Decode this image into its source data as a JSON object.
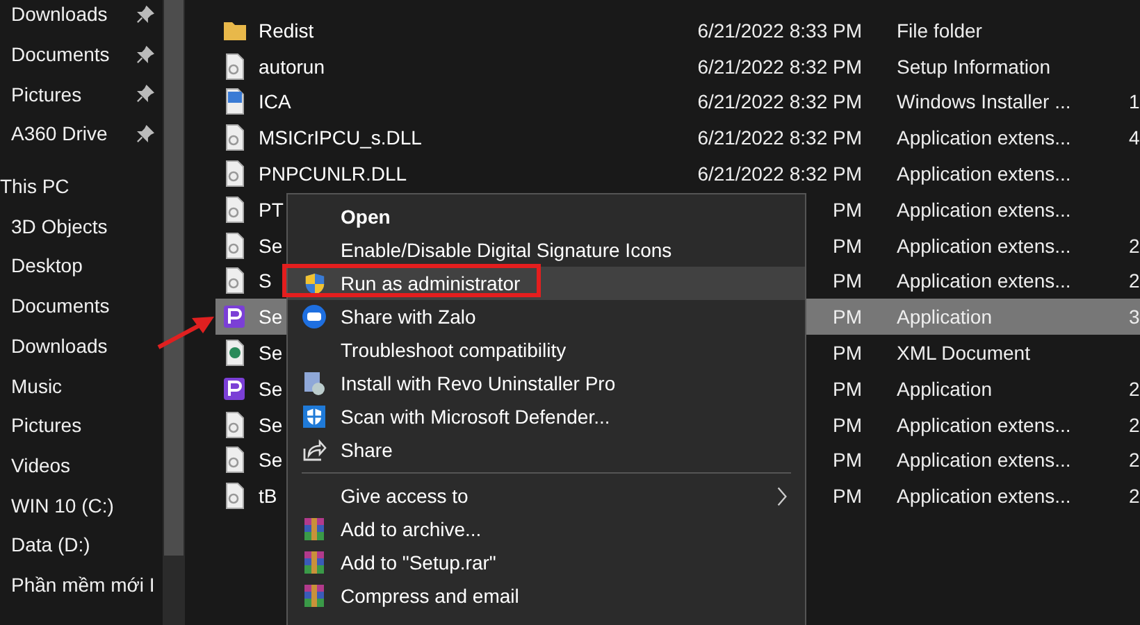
{
  "sidebar": {
    "items": [
      {
        "label": "Downloads",
        "kind": "item",
        "pinned": true
      },
      {
        "label": "Documents",
        "kind": "item",
        "pinned": true
      },
      {
        "label": "Pictures",
        "kind": "item",
        "pinned": true
      },
      {
        "label": "A360 Drive",
        "kind": "item",
        "pinned": true
      },
      {
        "label": "This PC",
        "kind": "header",
        "pinned": false
      },
      {
        "label": "3D Objects",
        "kind": "item",
        "pinned": false
      },
      {
        "label": "Desktop",
        "kind": "item",
        "pinned": false
      },
      {
        "label": "Documents",
        "kind": "item",
        "pinned": false
      },
      {
        "label": "Downloads",
        "kind": "item",
        "pinned": false
      },
      {
        "label": "Music",
        "kind": "item",
        "pinned": false
      },
      {
        "label": "Pictures",
        "kind": "item",
        "pinned": false
      },
      {
        "label": "Videos",
        "kind": "item",
        "pinned": false
      },
      {
        "label": "WIN 10 (C:)",
        "kind": "item",
        "pinned": false
      },
      {
        "label": "Data (D:)",
        "kind": "item",
        "pinned": false
      },
      {
        "label": "Phần mềm mới I",
        "kind": "item",
        "pinned": false
      }
    ]
  },
  "file_list": {
    "rows": [
      {
        "kind": "folder",
        "name": "Redist",
        "date": "6/21/2022 8:33 PM",
        "type": "File folder",
        "selected": false
      },
      {
        "kind": "setup",
        "name": "autorun",
        "date": "6/21/2022 8:32 PM",
        "type": "Setup Information",
        "selected": false
      },
      {
        "kind": "installer",
        "name": "ICA",
        "date": "6/21/2022 8:32 PM",
        "type": "Windows Installer ...",
        "size": "1",
        "selected": false
      },
      {
        "kind": "dll",
        "name": "MSICrIPCU_s.DLL",
        "date": "6/21/2022 8:32 PM",
        "type": "Application extens...",
        "size": "4",
        "selected": false
      },
      {
        "kind": "dll",
        "name": "PNPCUNLR.DLL",
        "date": "6/21/2022 8:32 PM",
        "type": "Application extens...",
        "selected": false
      },
      {
        "kind": "dll",
        "name": "PT",
        "date": "PM",
        "type": "Application extens...",
        "selected": false
      },
      {
        "kind": "dll",
        "name": "Se",
        "date": "PM",
        "type": "Application extens...",
        "size": "2",
        "selected": false
      },
      {
        "kind": "dll",
        "name": "S",
        "date": "PM",
        "type": "Application extens...",
        "size": "2",
        "selected": false
      },
      {
        "kind": "app",
        "name": "Se",
        "date": "PM",
        "type": "Application",
        "size": "3",
        "selected": true
      },
      {
        "kind": "xml",
        "name": "Se",
        "date": "PM",
        "type": "XML Document",
        "selected": false
      },
      {
        "kind": "app",
        "name": "Se",
        "date": "PM",
        "type": "Application",
        "size": "2",
        "selected": false
      },
      {
        "kind": "dll",
        "name": "Se",
        "date": "PM",
        "type": "Application extens...",
        "size": "2",
        "selected": false
      },
      {
        "kind": "dll",
        "name": "Se",
        "date": "PM",
        "type": "Application extens...",
        "size": "2",
        "selected": false
      },
      {
        "kind": "dll",
        "name": "tB",
        "date": "PM",
        "type": "Application extens...",
        "size": "2",
        "selected": false
      }
    ]
  },
  "context_menu": {
    "items": [
      {
        "kind": "plain",
        "label": "Open",
        "bold": true,
        "selected": false,
        "submenu": false
      },
      {
        "kind": "plain",
        "label": "Enable/Disable Digital Signature Icons",
        "bold": false,
        "selected": false,
        "submenu": false
      },
      {
        "kind": "shield",
        "label": "Run as administrator",
        "bold": false,
        "selected": true,
        "submenu": false
      },
      {
        "kind": "chat",
        "label": "Share with Zalo",
        "bold": false,
        "selected": false,
        "submenu": false
      },
      {
        "kind": "plain",
        "label": "Troubleshoot compatibility",
        "bold": false,
        "selected": false,
        "submenu": false
      },
      {
        "kind": "installer",
        "label": "Install with Revo Uninstaller Pro",
        "bold": false,
        "selected": false,
        "submenu": false
      },
      {
        "kind": "defender",
        "label": "Scan with Microsoft Defender...",
        "bold": false,
        "selected": false,
        "submenu": false
      },
      {
        "kind": "share",
        "label": "Share",
        "bold": false,
        "selected": false,
        "submenu": false
      },
      {
        "kind": "separator"
      },
      {
        "kind": "plain",
        "label": "Give access to",
        "bold": false,
        "selected": false,
        "submenu": true
      },
      {
        "kind": "archive",
        "label": "Add to archive...",
        "bold": false,
        "selected": false,
        "submenu": false
      },
      {
        "kind": "archive",
        "label": "Add to \"Setup.rar\"",
        "bold": false,
        "selected": false,
        "submenu": false
      },
      {
        "kind": "archive",
        "label": "Compress and email",
        "bold": false,
        "selected": false,
        "submenu": false
      }
    ]
  }
}
